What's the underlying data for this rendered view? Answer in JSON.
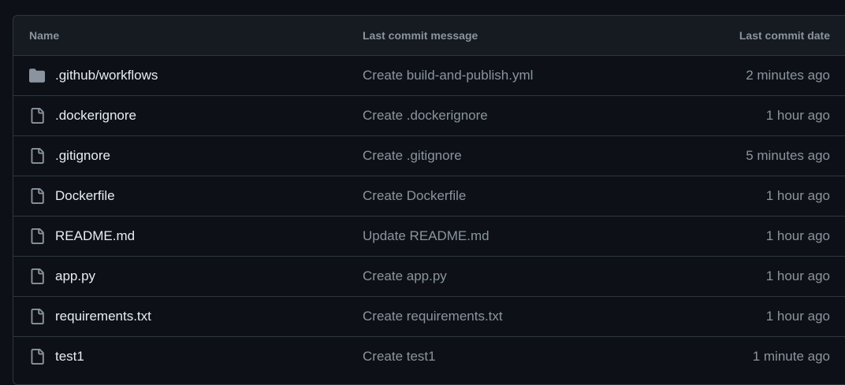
{
  "table": {
    "headers": {
      "name": "Name",
      "message": "Last commit message",
      "date": "Last commit date"
    },
    "rows": [
      {
        "name": "/workflows",
        "name_prefix": ".github",
        "message": "Create build-and-publish.yml",
        "date": "2 minutes ago",
        "icon": "folder-icon"
      },
      {
        "name": ".dockerignore",
        "message": "Create .dockerignore",
        "date": "1 hour ago",
        "icon": "file-icon"
      },
      {
        "name": ".gitignore",
        "message": "Create .gitignore",
        "date": "5 minutes ago",
        "icon": "file-icon"
      },
      {
        "name": "Dockerfile",
        "message": "Create Dockerfile",
        "date": "1 hour ago",
        "icon": "file-icon"
      },
      {
        "name": "README.md",
        "message": "Update README.md",
        "date": "1 hour ago",
        "icon": "file-icon"
      },
      {
        "name": "app.py",
        "message": "Create app.py",
        "date": "1 hour ago",
        "icon": "file-icon"
      },
      {
        "name": "requirements.txt",
        "message": "Create requirements.txt",
        "date": "1 hour ago",
        "icon": "file-icon"
      },
      {
        "name": "test1",
        "message": "Create test1",
        "date": "1 minute ago",
        "icon": "file-icon"
      }
    ]
  },
  "colors": {
    "background": "#0d1117",
    "header_background": "#161b22",
    "border": "#30363d",
    "primary_text": "#e6edf3",
    "muted_text": "#8b949e"
  }
}
